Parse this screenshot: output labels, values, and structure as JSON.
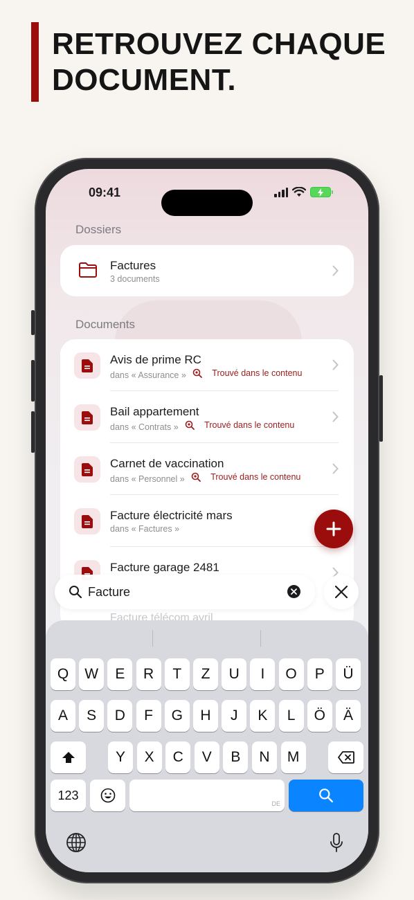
{
  "headline": "RETROUVEZ CHAQUE DOCUMENT.",
  "status": {
    "time": "09:41"
  },
  "folders": {
    "section_label": "Dossiers",
    "items": [
      {
        "name": "Factures",
        "count": "3 documents"
      }
    ]
  },
  "documents": {
    "section_label": "Documents",
    "items": [
      {
        "title": "Avis de prime RC",
        "folder": "dans « Assurance »",
        "match": "Trouvé dans le contenu"
      },
      {
        "title": "Bail appartement",
        "folder": "dans « Contrats »",
        "match": "Trouvé dans le contenu"
      },
      {
        "title": "Carnet de vaccination",
        "folder": "dans « Personnel »",
        "match": "Trouvé dans le contenu"
      },
      {
        "title": "Facture électricité mars",
        "folder": "dans « Factures »",
        "match": ""
      },
      {
        "title": "Facture garage 2481",
        "folder": "",
        "match": ""
      }
    ],
    "faded_item": "Facture télécom avril"
  },
  "search": {
    "value": "Facture"
  },
  "keyboard": {
    "row1": [
      "Q",
      "W",
      "E",
      "R",
      "T",
      "Z",
      "U",
      "I",
      "O",
      "P",
      "Ü"
    ],
    "row2": [
      "A",
      "S",
      "D",
      "F",
      "G",
      "H",
      "J",
      "K",
      "L",
      "Ö",
      "Ä"
    ],
    "row3": [
      "Y",
      "X",
      "C",
      "V",
      "B",
      "N",
      "M"
    ],
    "numbers_label": "123",
    "space_language": "DE"
  },
  "colors": {
    "accent": "#9b0d0d",
    "search_key": "#0a84ff"
  }
}
